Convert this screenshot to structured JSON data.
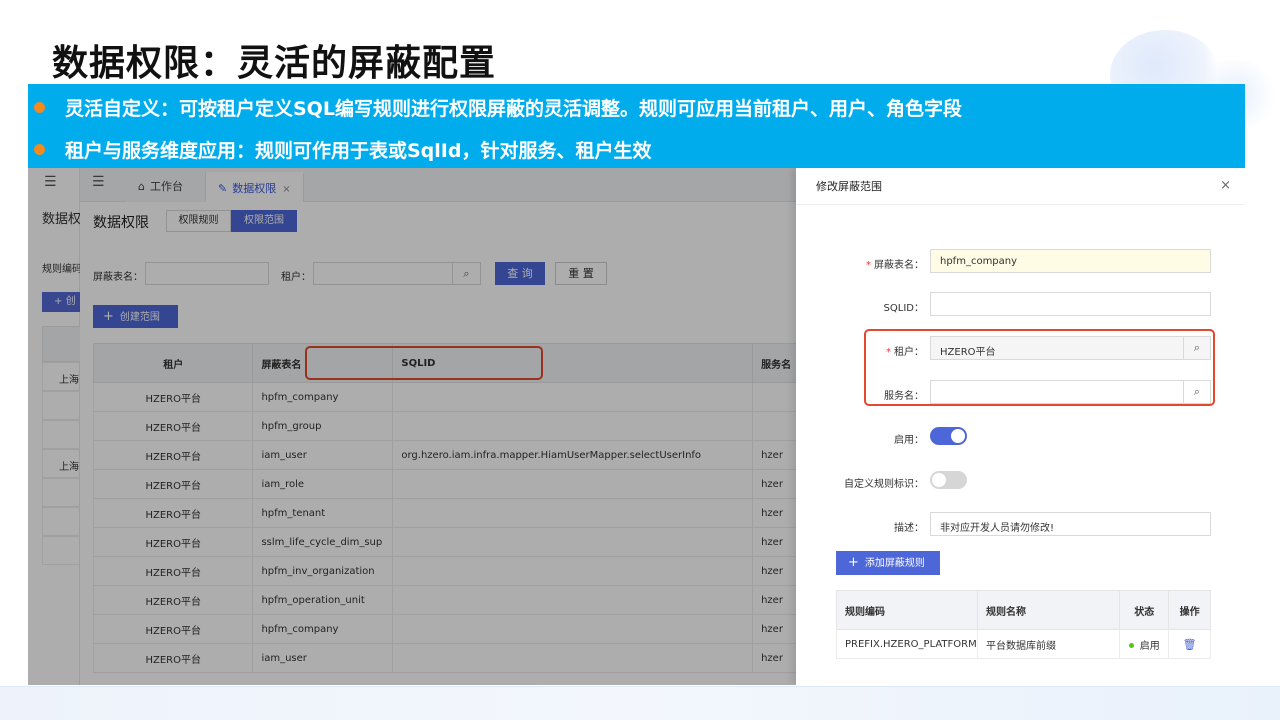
{
  "slide": {
    "title": "数据权限：灵活的屏蔽配置",
    "bullets": [
      "灵活自定义：可按租户定义SQL编写规则进行权限屏蔽的灵活调整。规则可应用当前租户、用户、角色字段",
      "租户与服务维度应用：规则可作用于表或SqlId，针对服务、租户生效"
    ],
    "colors": {
      "banner": "#00acec",
      "bullet_dot": "#f28a1e",
      "highlight": "#e24a2c",
      "primary": "#4d66d8"
    }
  },
  "left_panel": {
    "menu_icon": "menu-fold-icon",
    "title": "数据权限",
    "label": "规则编码",
    "create_label": "创",
    "rows": [
      "上海",
      "",
      "",
      "上海"
    ]
  },
  "app": {
    "tabs": [
      {
        "icon": "home-icon",
        "label": "工作台"
      },
      {
        "icon": "edit-icon",
        "label": "数据权限",
        "close": "×"
      }
    ],
    "page_title": "数据权限",
    "segments": [
      "权限规则",
      "权限范围"
    ],
    "filters": {
      "table_label": "屏蔽表名：",
      "tenant_label": "租户：",
      "query_button": "查 询",
      "reset_button": "重 置"
    },
    "create_button": "创建范围",
    "table": {
      "columns": [
        "租户",
        "屏蔽表名",
        "SQLID",
        "服务名"
      ],
      "rows": [
        [
          "HZERO平台",
          "hpfm_company",
          "",
          ""
        ],
        [
          "HZERO平台",
          "hpfm_group",
          "",
          ""
        ],
        [
          "HZERO平台",
          "iam_user",
          "org.hzero.iam.infra.mapper.HiamUserMapper.selectUserInfo",
          "hzer"
        ],
        [
          "HZERO平台",
          "iam_role",
          "",
          "hzer"
        ],
        [
          "HZERO平台",
          "hpfm_tenant",
          "",
          "hzer"
        ],
        [
          "HZERO平台",
          "sslm_life_cycle_dim_sup",
          "",
          "hzer"
        ],
        [
          "HZERO平台",
          "hpfm_inv_organization",
          "",
          "hzer"
        ],
        [
          "HZERO平台",
          "hpfm_operation_unit",
          "",
          "hzer"
        ],
        [
          "HZERO平台",
          "hpfm_company",
          "",
          "hzer"
        ],
        [
          "HZERO平台",
          "iam_user",
          "",
          "hzer"
        ]
      ]
    }
  },
  "drawer": {
    "title": "修改屏蔽范围",
    "close": "×",
    "fields": {
      "table_name": {
        "label": "屏蔽表名：",
        "value": "hpfm_company",
        "required": true
      },
      "sqlid": {
        "label": "SQLID：",
        "value": ""
      },
      "tenant": {
        "label": "租户：",
        "value": "HZERO平台",
        "required": true
      },
      "service": {
        "label": "服务名：",
        "value": ""
      },
      "enabled": {
        "label": "启用：",
        "value": true
      },
      "custom_rule": {
        "label": "自定义规则标识：",
        "value": false
      },
      "description": {
        "label": "描述：",
        "value": "非对应开发人员请勿修改!"
      }
    },
    "add_rule_button": "添加屏蔽规则",
    "rules_table": {
      "columns": [
        "规则编码",
        "规则名称",
        "状态",
        "操作"
      ],
      "rows": [
        {
          "code": "PREFIX.HZERO_PLATFORM",
          "name": "平台数据库前缀",
          "status": "启用",
          "action_icon": "trash-icon"
        }
      ]
    }
  }
}
